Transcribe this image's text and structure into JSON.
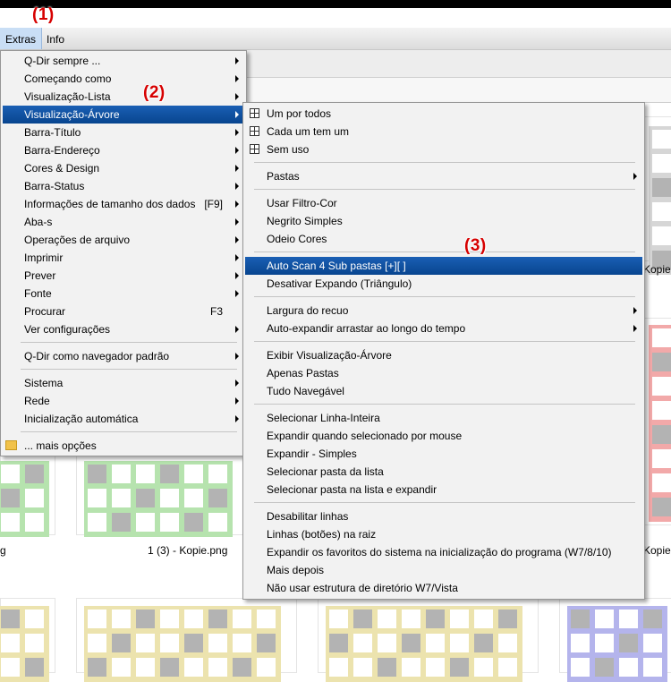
{
  "markers": {
    "m1": "(1)",
    "m2": "(2)",
    "m3": "(3)"
  },
  "menubar": {
    "extras": "Extras",
    "info": "Info"
  },
  "main_menu": [
    {
      "label": "Q-Dir sempre ...",
      "arrow": true
    },
    {
      "label": "Começando como",
      "arrow": true
    },
    {
      "label": "Visualização-Lista",
      "arrow": true
    },
    {
      "label": "Visualização-Árvore",
      "arrow": true,
      "highlighted": true
    },
    {
      "label": "Barra-Título",
      "arrow": true
    },
    {
      "label": "Barra-Endereço",
      "arrow": true
    },
    {
      "label": "Cores & Design",
      "arrow": true
    },
    {
      "label": "Barra-Status",
      "arrow": true
    },
    {
      "label": "Informações de tamanho dos dados",
      "shortcut": "[F9]",
      "arrow": true
    },
    {
      "label": "Aba-s",
      "arrow": true
    },
    {
      "label": "Operações de arquivo",
      "arrow": true
    },
    {
      "label": "Imprimir",
      "arrow": true
    },
    {
      "label": "Prever",
      "arrow": true
    },
    {
      "label": "Fonte",
      "arrow": true
    },
    {
      "label": "Procurar",
      "shortcut": "F3"
    },
    {
      "label": "Ver configurações",
      "arrow": true
    },
    {
      "label": "Q-Dir como navegador padrão",
      "arrow": true
    },
    {
      "label": "Sistema",
      "arrow": true
    },
    {
      "label": "Rede",
      "arrow": true
    },
    {
      "label": "Inicialização automática",
      "arrow": true
    },
    {
      "label": "... mais opções"
    }
  ],
  "sub_menu": [
    {
      "label": "Um por todos"
    },
    {
      "label": "Cada um tem um"
    },
    {
      "label": "Sem uso"
    },
    {
      "label": "Pastas",
      "arrow": true
    },
    {
      "label": "Usar Filtro-Cor"
    },
    {
      "label": "Negrito Simples"
    },
    {
      "label": "Odeio Cores"
    },
    {
      "label": "Auto Scan 4 Sub pastas [+][ ]",
      "highlighted": true
    },
    {
      "label": "Desativar Expando (Triângulo)"
    },
    {
      "label": "Largura do recuo",
      "arrow": true
    },
    {
      "label": "Auto-expandir arrastar ao longo do tempo",
      "arrow": true
    },
    {
      "label": "Exibir Visualização-Árvore"
    },
    {
      "label": "Apenas Pastas"
    },
    {
      "label": "Tudo Navegável"
    },
    {
      "label": "Selecionar Linha-Inteira"
    },
    {
      "label": "Expandir quando selecionado por mouse"
    },
    {
      "label": "Expandir - Simples"
    },
    {
      "label": "Selecionar pasta da lista"
    },
    {
      "label": "Selecionar pasta na lista e expandir"
    },
    {
      "label": "Desabilitar linhas"
    },
    {
      "label": "Linhas (botões) na raiz"
    },
    {
      "label": "Expandir os favoritos do sistema na inicialização do programa (W7/8/10)"
    },
    {
      "label": "Mais depois"
    },
    {
      "label": "Não usar estrutura de diretório W7/Vista"
    }
  ],
  "background": {
    "file_label": "1 (3) - Kopie.png",
    "kopie_1": "Kopie",
    "kopie_2": "Kopie",
    "tile_colors": {
      "gray": "#d6d6d6",
      "red": "#f2a9a9",
      "green": "#b6e3ae",
      "yellow": "#ece3ae",
      "blue": "#b4b4ec",
      "dark": "#b3b3b3"
    }
  }
}
